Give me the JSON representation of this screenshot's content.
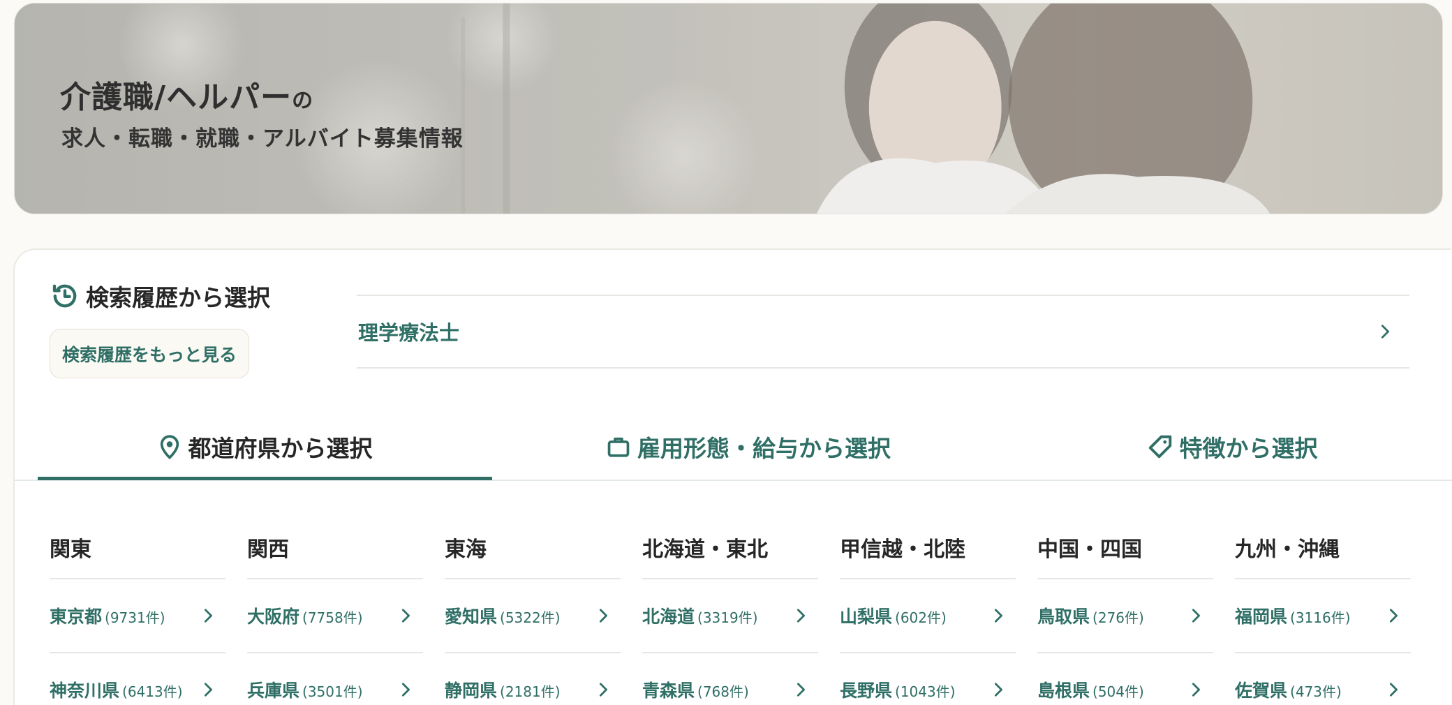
{
  "hero": {
    "title": "介護職/ヘルパー",
    "title_suffix": "の",
    "subtitle": "求人・転職・就職・アルバイト募集情報"
  },
  "history": {
    "heading": "検索履歴から選択",
    "more_button": "検索履歴をもっと見る",
    "items": [
      {
        "label": "理学療法士"
      }
    ]
  },
  "tabs": [
    {
      "label": "都道府県から選択",
      "icon": "location-pin-icon",
      "active": true
    },
    {
      "label": "雇用形態・給与から選択",
      "icon": "briefcase-icon",
      "active": false
    },
    {
      "label": "特徴から選択",
      "icon": "tag-icon",
      "active": false
    }
  ],
  "regions": [
    {
      "name": "関東",
      "prefs": [
        {
          "name": "東京都",
          "count": "(9731件)"
        },
        {
          "name": "神奈川県",
          "count": "(6413件)"
        }
      ]
    },
    {
      "name": "関西",
      "prefs": [
        {
          "name": "大阪府",
          "count": "(7758件)"
        },
        {
          "name": "兵庫県",
          "count": "(3501件)"
        }
      ]
    },
    {
      "name": "東海",
      "prefs": [
        {
          "name": "愛知県",
          "count": "(5322件)"
        },
        {
          "name": "静岡県",
          "count": "(2181件)"
        }
      ]
    },
    {
      "name": "北海道・東北",
      "prefs": [
        {
          "name": "北海道",
          "count": "(3319件)"
        },
        {
          "name": "青森県",
          "count": "(768件)"
        }
      ]
    },
    {
      "name": "甲信越・北陸",
      "prefs": [
        {
          "name": "山梨県",
          "count": "(602件)"
        },
        {
          "name": "長野県",
          "count": "(1043件)"
        }
      ]
    },
    {
      "name": "中国・四国",
      "prefs": [
        {
          "name": "鳥取県",
          "count": "(276件)"
        },
        {
          "name": "島根県",
          "count": "(504件)"
        }
      ]
    },
    {
      "name": "九州・沖縄",
      "prefs": [
        {
          "name": "福岡県",
          "count": "(3116件)"
        },
        {
          "name": "佐賀県",
          "count": "(473件)"
        }
      ]
    }
  ],
  "colors": {
    "accent": "#2f6f66",
    "background": "#fbfaf6"
  }
}
